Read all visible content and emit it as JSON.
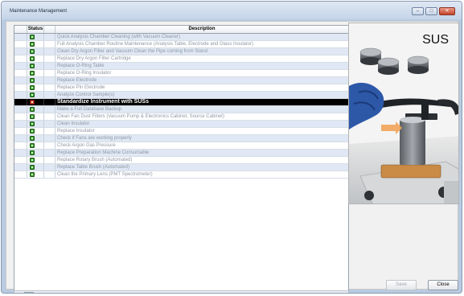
{
  "window": {
    "title": "Maintenance Management",
    "controls": {
      "minimize": "–",
      "maximize": "□",
      "close": "✕"
    }
  },
  "table": {
    "headers": {
      "status": "Status",
      "description": "Description"
    },
    "rows": [
      {
        "description": "Quick Analysis Chamber Cleaning (with Vacuum Cleaner)",
        "selected": false
      },
      {
        "description": "Full Analysis Chamber Routine Maintenance (Analysis Table, Electrode and Glass Insulator)",
        "selected": false
      },
      {
        "description": "Clean Dry Argon Filter and Vacuum Clean the Pipe coming from Stand",
        "selected": false
      },
      {
        "description": "Replace Dry Argon Filter Cartridge",
        "selected": false
      },
      {
        "description": "Replace O-Ring Table",
        "selected": false
      },
      {
        "description": "Replace O-Ring Insulator",
        "selected": false
      },
      {
        "description": "Replace Electrode",
        "selected": false
      },
      {
        "description": "Replace Pin Electrode",
        "selected": false
      },
      {
        "description": "Analyze Control Sample(s)",
        "selected": false
      },
      {
        "description": "Standardize Instrument with SUSs",
        "selected": true
      },
      {
        "description": "Make a Full Database Backup",
        "selected": false
      },
      {
        "description": "Clean Fan Dust Filters (Vacuum Pump & Electronics Cabinet, Source Cabinet)",
        "selected": false
      },
      {
        "description": "Clean Insulator",
        "selected": false
      },
      {
        "description": "Replace Insulator",
        "selected": false
      },
      {
        "description": "Check if Fans are working properly",
        "selected": false
      },
      {
        "description": "Check Argon Gas Pressure",
        "selected": false
      },
      {
        "description": "Replace Preparation Machine Consumable",
        "selected": false
      },
      {
        "description": "Replace Rotary Brush (Automated)",
        "selected": false
      },
      {
        "description": "Replace Table Brush (Automated)",
        "selected": false
      },
      {
        "description": "Clean the Primary Lens (PMT Spectrometer)",
        "selected": false
      }
    ],
    "selected_marker": "▶"
  },
  "scrollbar": {
    "left_arrow": "◂",
    "right_arrow": "▸"
  },
  "illustration": {
    "label": "SUS"
  },
  "buttons": {
    "save": "Save",
    "close": "Close"
  },
  "colors": {
    "selected_row": "#000000",
    "status_ok": "#3a9f2e",
    "status_due": "#d23a2a"
  }
}
